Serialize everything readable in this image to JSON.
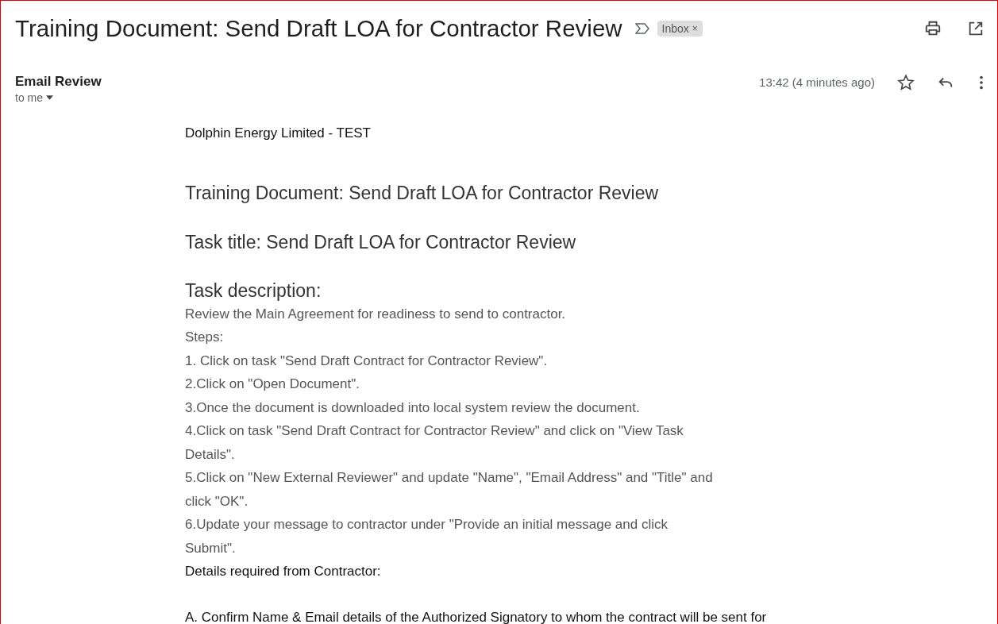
{
  "subject": {
    "title": "Training Document: Send Draft LOA for Contractor Review",
    "label": "Inbox",
    "label_remove": "×"
  },
  "message": {
    "sender": "Email Review",
    "recipient": "to me",
    "time": "13:42 (4 minutes ago)",
    "starred": false
  },
  "body": [
    {
      "kind": "plain",
      "text": "Dolphin Energy Limited - TEST"
    },
    {
      "kind": "heading",
      "text": "Training Document: Send Draft LOA for Contractor Review"
    },
    {
      "kind": "heading",
      "text": "Task title: Send Draft LOA for Contractor Review"
    },
    {
      "kind": "subheading",
      "text": "Task description:"
    },
    {
      "kind": "step",
      "text": "Review the Main Agreement for readiness to send to contractor."
    },
    {
      "kind": "step",
      "text": "Steps:"
    },
    {
      "kind": "step",
      "text": "1. Click on task \"Send Draft Contract for Contractor Review\"."
    },
    {
      "kind": "step",
      "text": "2.Click on \"Open Document\"."
    },
    {
      "kind": "step",
      "text": "3.Once the document is downloaded into local system review the document."
    },
    {
      "kind": "step",
      "text": "4.Click on task \"Send Draft Contract for Contractor Review\" and click on \"View Task Details\"."
    },
    {
      "kind": "step",
      "text": "5.Click on \"New External Reviewer\" and update \"Name\", \"Email Address\" and \"Title\" and click \"OK\"."
    },
    {
      "kind": "step",
      "text": "6.Update your message to contractor under \"Provide an initial message and click Submit\"."
    },
    {
      "kind": "label",
      "text": "Details required from Contractor:"
    },
    {
      "kind": "item",
      "text": "A. Confirm Name & Email details of the Authorized Signatory to whom the contract will be sent for"
    }
  ]
}
